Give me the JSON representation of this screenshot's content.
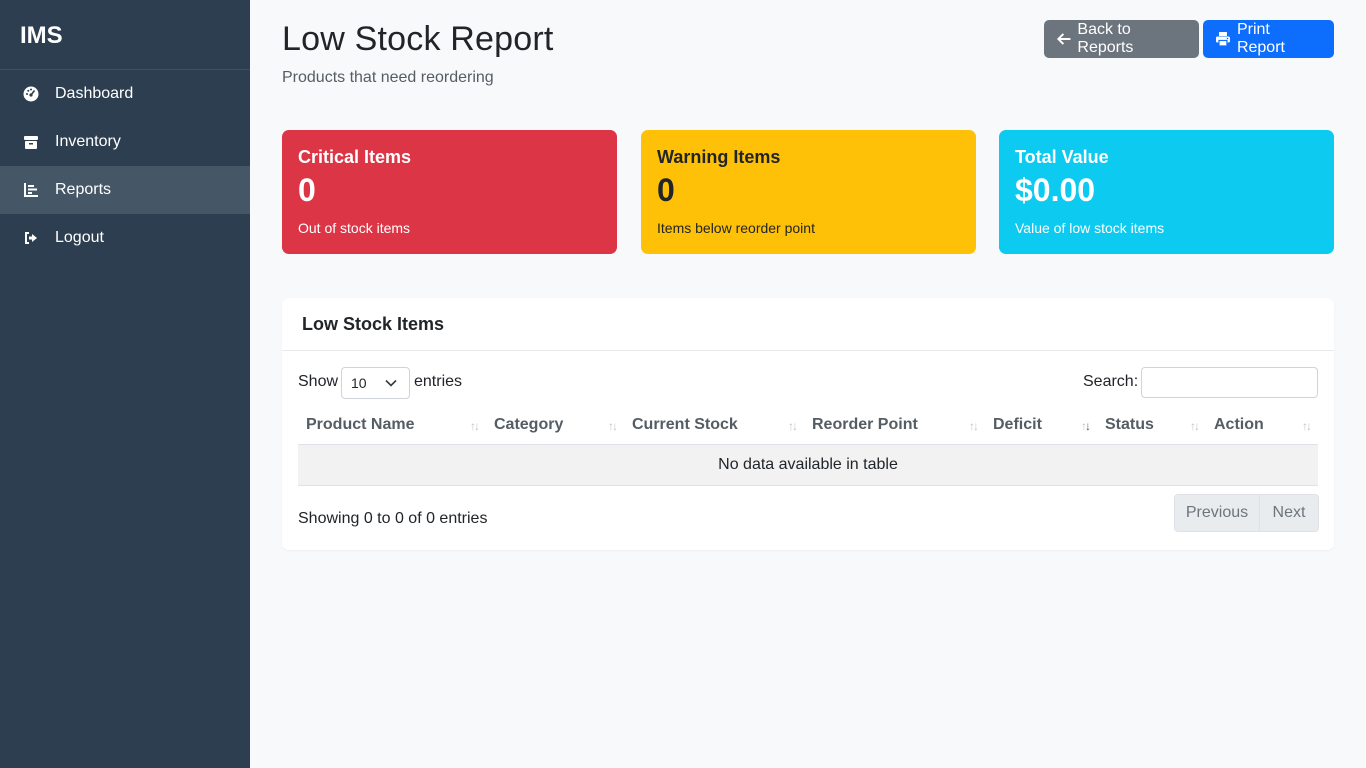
{
  "sidebar": {
    "brand": "IMS",
    "items": [
      {
        "label": "Dashboard",
        "icon": "gauge-icon"
      },
      {
        "label": "Inventory",
        "icon": "box-icon"
      },
      {
        "label": "Reports",
        "icon": "chart-bar-icon"
      },
      {
        "label": "Logout",
        "icon": "logout-icon"
      }
    ],
    "active": "Reports"
  },
  "header": {
    "title": "Low Stock Report",
    "subtitle": "Products that need reordering",
    "back_label": "Back to Reports",
    "print_label": "Print Report"
  },
  "cards": [
    {
      "title": "Critical Items",
      "value": "0",
      "desc": "Out of stock items",
      "color": "#dc3545"
    },
    {
      "title": "Warning Items",
      "value": "0",
      "desc": "Items below reorder point",
      "color": "#ffc107"
    },
    {
      "title": "Total Value",
      "value": "$0.00",
      "desc": "Value of low stock items",
      "color": "#0dcaf0"
    }
  ],
  "table_panel": {
    "title": "Low Stock Items",
    "show_label": "Show",
    "page_size": "10",
    "entries_label": "entries",
    "search_label": "Search:",
    "search_value": "",
    "columns": [
      "Product Name",
      "Category",
      "Current Stock",
      "Reorder Point",
      "Deficit",
      "Status",
      "Action"
    ],
    "sorted_column": "Deficit",
    "empty_message": "No data available in table",
    "info": "Showing 0 to 0 of 0 entries",
    "prev_label": "Previous",
    "next_label": "Next"
  }
}
